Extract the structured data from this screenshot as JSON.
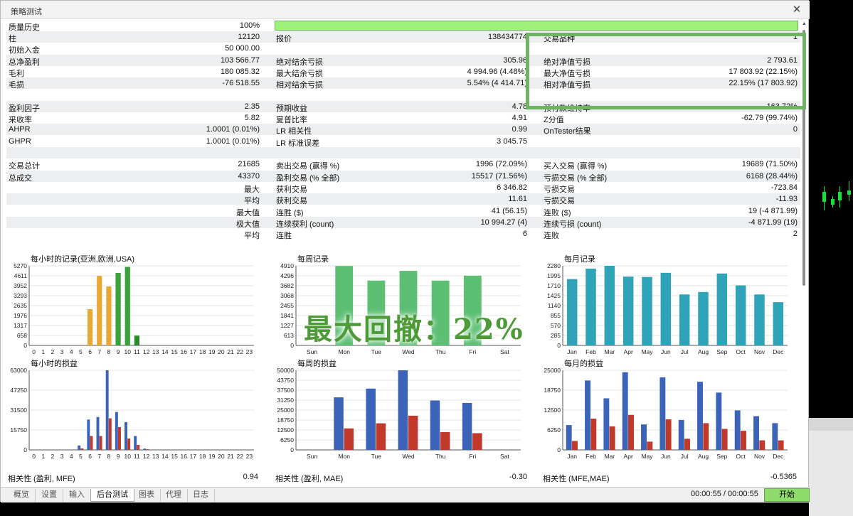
{
  "window": {
    "title": "策略测试",
    "close_icon": "close-icon"
  },
  "quality": {
    "label": "质量历史",
    "value": "100%",
    "bar_percent": 100,
    "bar_color": "#9ef27c"
  },
  "stats": [
    {
      "l1": "柱",
      "v1": "12120",
      "l2": "报价",
      "v2": "138434774",
      "l3": "交易品种",
      "v3": "1",
      "shade": true
    },
    {
      "l1": "初始入金",
      "v1": "50 000.00",
      "l2": "",
      "v2": "",
      "l3": "",
      "v3": "",
      "shade": false
    },
    {
      "l1": "总净盈利",
      "v1": "103 566.77",
      "l2": "绝对结余亏损",
      "v2": "305.96",
      "l3": "绝对净值亏损",
      "v3": "2 793.61",
      "shade": true
    },
    {
      "l1": "毛利",
      "v1": "180 085.32",
      "l2": "最大结余亏损",
      "v2": "4 994.96 (4.48%)",
      "l3": "最大净值亏损",
      "v3": "17 803.92 (22.15%)",
      "shade": false
    },
    {
      "l1": "毛损",
      "v1": "-76 518.55",
      "l2": "相对结余亏损",
      "v2": "5.54% (4 414.71)",
      "l3": "相对净值亏损",
      "v3": "22.15% (17 803.92)",
      "shade": true
    },
    {
      "l1": "",
      "v1": "",
      "l2": "",
      "v2": "",
      "l3": "",
      "v3": "",
      "shade": false
    },
    {
      "l1": "盈利因子",
      "v1": "2.35",
      "l2": "预期收益",
      "v2": "4.78",
      "l3": "预付款维持率",
      "v3": "163.72%",
      "shade": true
    },
    {
      "l1": "采收率",
      "v1": "5.82",
      "l2": "夏普比率",
      "v2": "4.91",
      "l3": "Z分值",
      "v3": "-62.79 (99.74%)",
      "shade": false
    },
    {
      "l1": "AHPR",
      "v1": "1.0001 (0.01%)",
      "l2": "LR 相关性",
      "v2": "0.99",
      "l3": "OnTester结果",
      "v3": "0",
      "shade": true
    },
    {
      "l1": "GHPR",
      "v1": "1.0001 (0.01%)",
      "l2": "LR 标准误差",
      "v2": "3 045.75",
      "l3": "",
      "v3": "",
      "shade": false
    },
    {
      "l1": "",
      "v1": "",
      "l2": "",
      "v2": "",
      "l3": "",
      "v3": "",
      "shade": true
    },
    {
      "l1": "交易总计",
      "v1": "21685",
      "l2": "卖出交易 (赢得 %)",
      "v2": "1996 (72.09%)",
      "l3": "买入交易 (赢得 %)",
      "v3": "19689 (71.50%)",
      "shade": false
    },
    {
      "l1": "总成交",
      "v1": "43370",
      "l2": "盈利交易 (% 全部)",
      "v2": "15517 (71.56%)",
      "l3": "亏损交易 (% 全部)",
      "v3": "6168 (28.44%)",
      "shade": true
    },
    {
      "l1": "最大",
      "v1": "",
      "l2": "获利交易",
      "v2": "6 346.82",
      "l3": "亏损交易",
      "v3": "-723.84",
      "shade": false,
      "right": true
    },
    {
      "l1": "平均",
      "v1": "",
      "l2": "获利交易",
      "v2": "11.61",
      "l3": "亏损交易",
      "v3": "-11.93",
      "shade": true,
      "right": true
    },
    {
      "l1": "最大值",
      "v1": "",
      "l2": "连胜 ($)",
      "v2": "41 (56.15)",
      "l3": "连败 ($)",
      "v3": "19 (-4 871.99)",
      "shade": false,
      "right": true
    },
    {
      "l1": "极大值",
      "v1": "",
      "l2": "连续获利 (count)",
      "v2": "10 994.27 (4)",
      "l3": "连续亏损 (count)",
      "v3": "-4 871.99 (19)",
      "shade": true,
      "right": true
    },
    {
      "l1": "平均",
      "v1": "",
      "l2": "连胜",
      "v2": "6",
      "l3": "连败",
      "v3": "2",
      "shade": false,
      "right": true
    }
  ],
  "charts": [
    {
      "id": "hourly-entries",
      "title": "每小时的记录(亚洲,欧洲,USA)",
      "type": "bar",
      "yticks": [
        "5270",
        "4611",
        "3952",
        "3293",
        "2635",
        "1976",
        "1317",
        "658",
        "0"
      ],
      "ymax": 5270,
      "categories": [
        "0",
        "1",
        "2",
        "3",
        "4",
        "5",
        "6",
        "7",
        "8",
        "9",
        "10",
        "11",
        "12",
        "13",
        "14",
        "15",
        "16",
        "17",
        "18",
        "19",
        "20",
        "21",
        "22",
        "23"
      ],
      "values": [
        0,
        0,
        0,
        0,
        0,
        0,
        2400,
        4600,
        3900,
        4800,
        5200,
        650,
        0,
        0,
        0,
        0,
        0,
        0,
        0,
        0,
        0,
        0,
        0,
        0
      ],
      "colors": [
        "#e8a834",
        "#e8a834",
        "#e8a834",
        "#e8a834",
        "#e8a834",
        "#e8a834",
        "#e8a834",
        "#e8a834",
        "#e8a834",
        "#3aa23a",
        "#3aa23a",
        "#2a8a2a",
        "#2a8a2a",
        "#2a8a2a",
        "#2a8a2a",
        "#2a8a2a",
        "#2a8a2a",
        "#2a8a2a",
        "#2a8a2a",
        "#2a8a2a",
        "#2a8a2a",
        "#2a8a2a",
        "#2a8a2a",
        "#2a8a2a"
      ]
    },
    {
      "id": "weekly-entries",
      "title": "每周记录",
      "type": "bar",
      "yticks": [
        "4910",
        "4296",
        "3682",
        "3068",
        "2455",
        "1841",
        "1227",
        "613",
        "0"
      ],
      "ymax": 4910,
      "categories": [
        "Sun",
        "Mon",
        "Tue",
        "Wed",
        "Thu",
        "Fri",
        "Sat"
      ],
      "values": [
        0,
        4900,
        4000,
        4600,
        4000,
        4300,
        0
      ],
      "colors": [
        "#5cbf73"
      ]
    },
    {
      "id": "monthly-entries",
      "title": "每月记录",
      "type": "bar",
      "yticks": [
        "2280",
        "1995",
        "1710",
        "1425",
        "1140",
        "855",
        "570",
        "285",
        "0"
      ],
      "ymax": 2280,
      "categories": [
        "Jan",
        "Feb",
        "Mar",
        "Apr",
        "May",
        "Jun",
        "Jul",
        "Aug",
        "Sep",
        "Oct",
        "Nov",
        "Dec"
      ],
      "values": [
        1900,
        2200,
        2280,
        1970,
        1960,
        2080,
        1460,
        1530,
        2060,
        1720,
        1460,
        1240
      ],
      "colors": [
        "#2fa3b8"
      ]
    },
    {
      "id": "hourly-pnl",
      "title": "每小时的损益",
      "type": "bar2",
      "yticks": [
        "63000",
        "47250",
        "31500",
        "15750",
        "0"
      ],
      "ymax": 63000,
      "categories": [
        "0",
        "1",
        "2",
        "3",
        "4",
        "5",
        "6",
        "7",
        "8",
        "9",
        "10",
        "11",
        "12",
        "13",
        "14",
        "15",
        "16",
        "17",
        "18",
        "19",
        "20",
        "21",
        "22",
        "23"
      ],
      "series": [
        {
          "name": "",
          "values": [
            0,
            0,
            0,
            0,
            0,
            3500,
            24000,
            26000,
            63000,
            30000,
            22000,
            11000,
            1000,
            0,
            0,
            0,
            0,
            0,
            0,
            0,
            0,
            0,
            0,
            0
          ],
          "color": "#3b63b8"
        },
        {
          "name": "",
          "values": [
            0,
            0,
            0,
            0,
            0,
            1200,
            11000,
            11000,
            25000,
            18000,
            9000,
            4000,
            500,
            0,
            0,
            0,
            0,
            0,
            0,
            0,
            0,
            0,
            0,
            0
          ],
          "color": "#c0392b"
        }
      ]
    },
    {
      "id": "weekly-pnl",
      "title": "每周的损益",
      "type": "bar2",
      "yticks": [
        "50000",
        "43750",
        "37500",
        "31250",
        "25000",
        "18750",
        "12500",
        "6250",
        "0"
      ],
      "ymax": 50000,
      "categories": [
        "Sun",
        "Mon",
        "Tue",
        "Wed",
        "Thu",
        "Fri",
        "Sat"
      ],
      "series": [
        {
          "name": "",
          "values": [
            0,
            33000,
            38500,
            50000,
            31000,
            29500,
            0
          ],
          "color": "#3b63b8"
        },
        {
          "name": "",
          "values": [
            0,
            13500,
            16700,
            21500,
            11200,
            10500,
            0
          ],
          "color": "#c0392b"
        }
      ]
    },
    {
      "id": "monthly-pnl",
      "title": "每月的损益",
      "type": "bar2",
      "yticks": [
        "25000",
        "18750",
        "12500",
        "6250",
        "0"
      ],
      "ymax": 25000,
      "categories": [
        "Jan",
        "Feb",
        "Mar",
        "Apr",
        "May",
        "Jun",
        "Jul",
        "Aug",
        "Sep",
        "Oct",
        "Nov",
        "Dec"
      ],
      "series": [
        {
          "name": "",
          "values": [
            7800,
            21800,
            16200,
            24400,
            8000,
            22800,
            9400,
            21400,
            18000,
            12400,
            10600,
            8400
          ],
          "color": "#3b63b8"
        },
        {
          "name": "",
          "values": [
            2800,
            9800,
            7400,
            11000,
            2600,
            9600,
            3500,
            8400,
            6600,
            6000,
            3000,
            3000
          ],
          "color": "#c0392b"
        }
      ]
    }
  ],
  "correlations": [
    {
      "label": "相关性 (盈利, MFE)",
      "value": "0.94"
    },
    {
      "label": "相关性 (盈利, MAE)",
      "value": "-0.30"
    },
    {
      "label": "相关性 (MFE,MAE)",
      "value": "-0.5365"
    }
  ],
  "overlay": {
    "text": "最大回撤：22%",
    "color": "#4e9a38"
  },
  "tabs": [
    {
      "label": "概览",
      "active": false
    },
    {
      "label": "设置",
      "active": false
    },
    {
      "label": "输入",
      "active": false
    },
    {
      "label": "后台测试",
      "active": true
    },
    {
      "label": "图表",
      "active": false
    },
    {
      "label": "代理",
      "active": false
    },
    {
      "label": "日志",
      "active": false
    }
  ],
  "timer": "00:00:55 / 00:00:55",
  "start_button": "开始"
}
